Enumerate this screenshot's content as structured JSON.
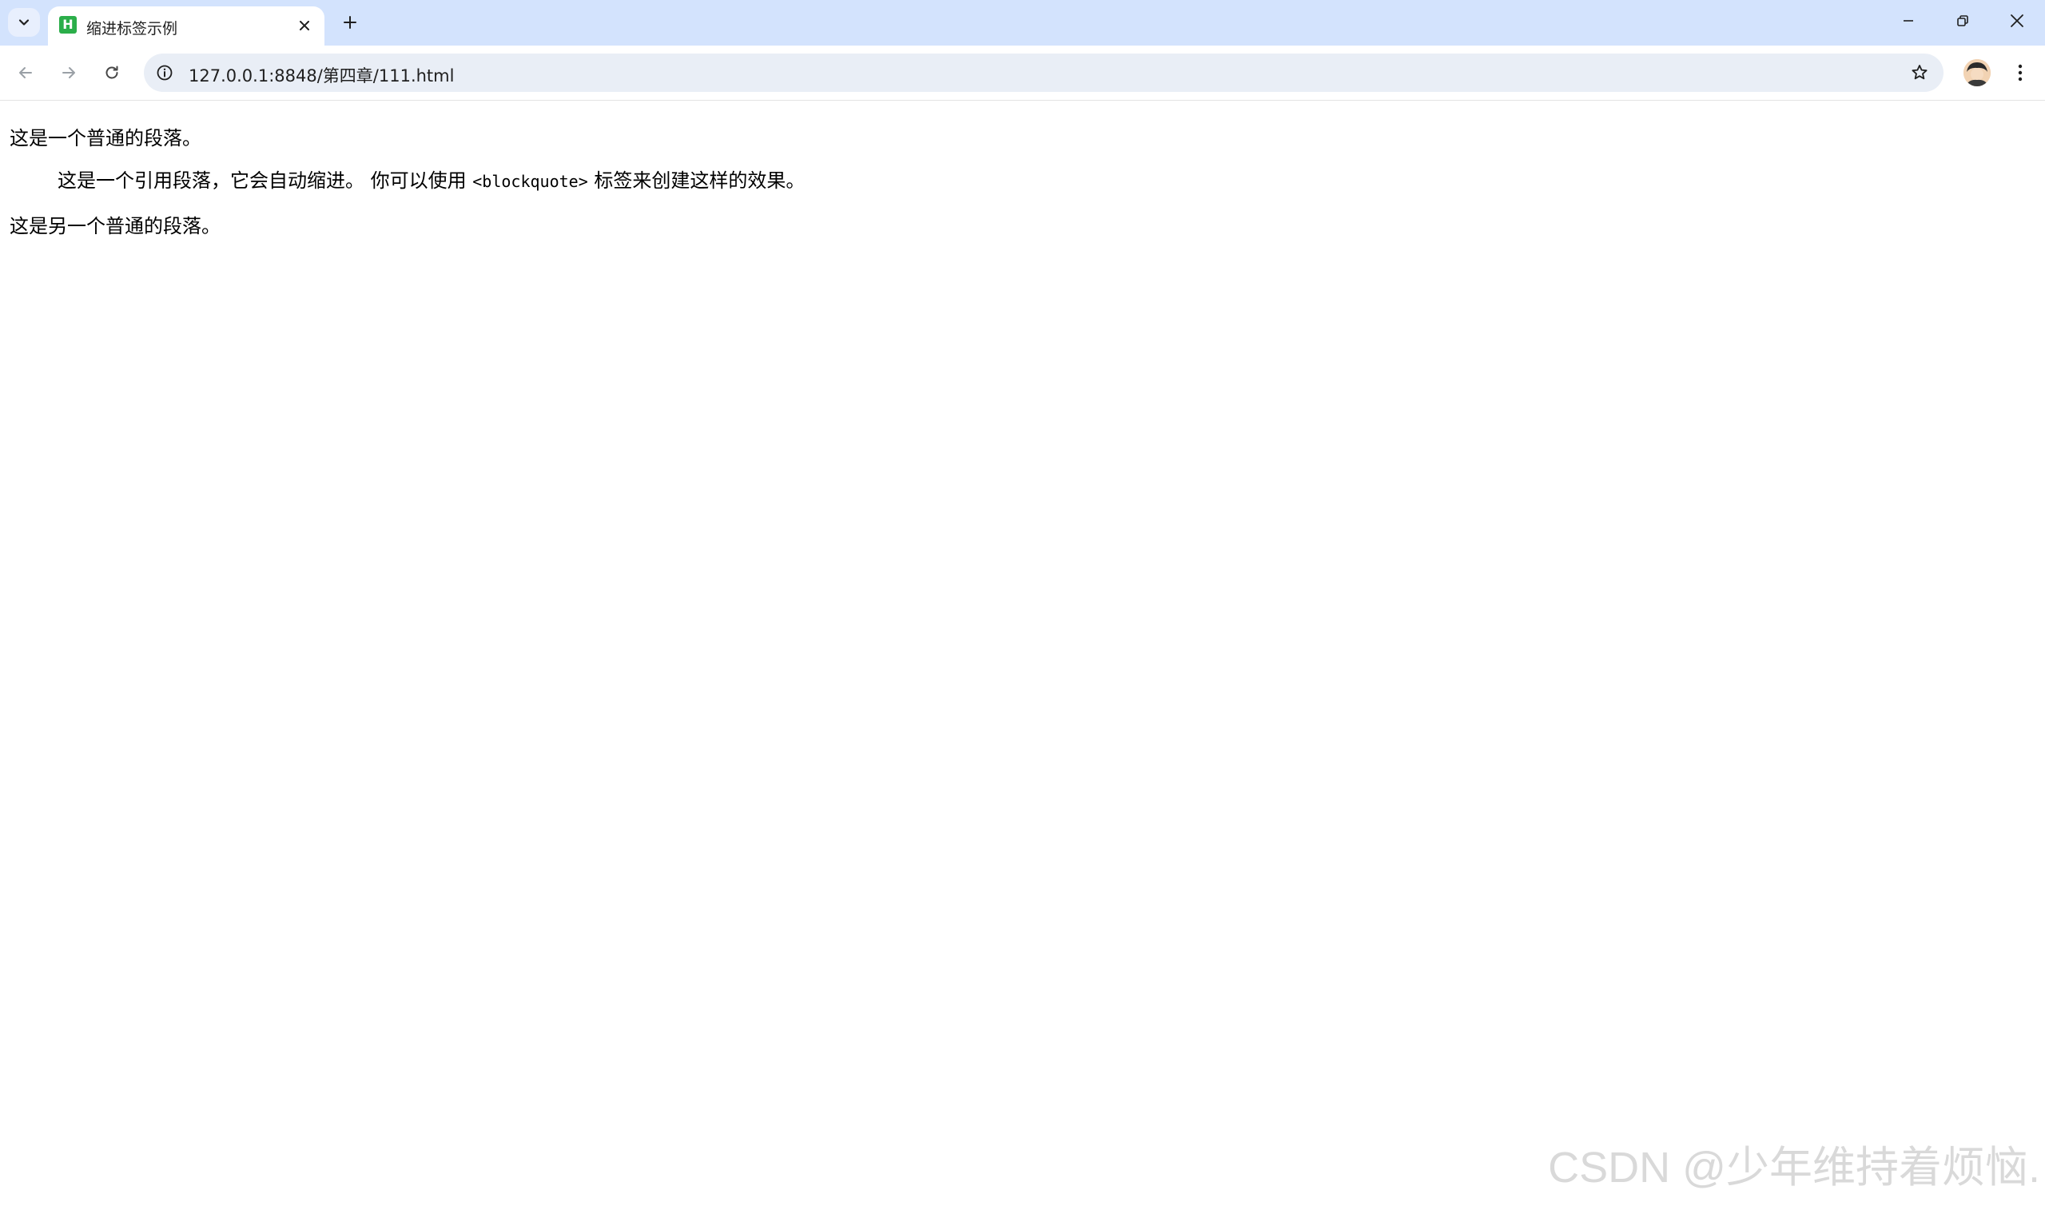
{
  "browser": {
    "tab": {
      "title": "缩进标签示例",
      "favicon_letter": "H"
    },
    "address_bar": {
      "url": "127.0.0.1:8848/第四章/111.html"
    }
  },
  "page": {
    "paragraph_1": "这是一个普通的段落。",
    "blockquote": {
      "text_before": "这是一个引用段落，它会自动缩进。 你可以使用 ",
      "code": "<blockquote>",
      "text_after": " 标签来创建这样的效果。"
    },
    "paragraph_2": "这是另一个普通的段落。"
  },
  "watermark": "CSDN @少年维持着烦恼.",
  "colors": {
    "tabstrip_bg": "#d3e3fd",
    "omnibox_bg": "#e9eef6",
    "favicon": "#2bae4a",
    "watermark": "#d9d9d9"
  }
}
